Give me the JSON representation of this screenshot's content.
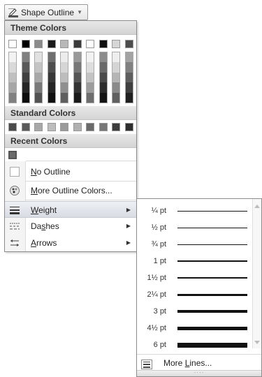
{
  "button": {
    "label": "Shape Outline",
    "icon": "pen-outline-icon"
  },
  "menu": {
    "theme_colors_header": "Theme Colors",
    "theme_top": [
      "#ffffff",
      "#000000",
      "#8a8a8a",
      "#1a1a1a",
      "#b8b8b8",
      "#3a3a3a",
      "#ffffff",
      "#0f0f0f",
      "#d6d6d6",
      "#4d4d4d"
    ],
    "theme_shades": [
      [
        "#f2f2f2",
        "#d9d9d9",
        "#bfbfbf",
        "#a6a6a6",
        "#808080"
      ],
      [
        "#7f7f7f",
        "#595959",
        "#404040",
        "#262626",
        "#0d0d0d"
      ],
      [
        "#e1e1e1",
        "#c4c4c4",
        "#a8a8a8",
        "#7a7a7a",
        "#525252"
      ],
      [
        "#6e6e6e",
        "#4e4e4e",
        "#383838",
        "#252525",
        "#111111"
      ],
      [
        "#ececec",
        "#d6d6d6",
        "#bdbdbd",
        "#8f8f8f",
        "#5f5f5f"
      ],
      [
        "#999999",
        "#777777",
        "#555555",
        "#333333",
        "#1a1a1a"
      ],
      [
        "#f2f2f2",
        "#dddddd",
        "#c3c3c3",
        "#9c9c9c",
        "#6d6d6d"
      ],
      [
        "#8c8c8c",
        "#6a6a6a",
        "#4a4a4a",
        "#2c2c2c",
        "#141414"
      ],
      [
        "#eeeeee",
        "#d4d4d4",
        "#b5b5b5",
        "#8a8a8a",
        "#606060"
      ],
      [
        "#a3a3a3",
        "#808080",
        "#5e5e5e",
        "#3f3f3f",
        "#202020"
      ]
    ],
    "standard_colors_header": "Standard Colors",
    "standard": [
      "#4a4a4a",
      "#5a5a5a",
      "#a8a8a8",
      "#bdbdbd",
      "#9a9a9a",
      "#b0b0b0",
      "#6a6a6a",
      "#777777",
      "#3d3d3d",
      "#2e2e2e"
    ],
    "recent_colors_header": "Recent Colors",
    "recent": [
      "#6b6b6b"
    ],
    "no_outline": {
      "pre": "",
      "key": "N",
      "rest": "o Outline",
      "icon": "no-outline-icon"
    },
    "more_colors": {
      "pre": "",
      "key": "M",
      "rest": "ore Outline Colors...",
      "icon": "color-palette-icon"
    },
    "weight": {
      "pre": "",
      "key": "W",
      "rest": "eight",
      "icon": "weight-lines-icon"
    },
    "dashes": {
      "pre": "Da",
      "key": "s",
      "rest": "hes",
      "icon": "dashes-icon"
    },
    "arrows": {
      "pre": "",
      "key": "A",
      "rest": "rrows",
      "icon": "arrows-icon"
    },
    "submenu_arrow": "▶"
  },
  "weight_menu": {
    "options": [
      "¼ pt",
      "½ pt",
      "¾ pt",
      "1 pt",
      "1½ pt",
      "2¼ pt",
      "3 pt",
      "4½ pt",
      "6 pt"
    ],
    "more_lines": {
      "pre": "More ",
      "key": "L",
      "rest": "ines...",
      "icon": "line-weight-icon"
    },
    "grip": "····"
  }
}
